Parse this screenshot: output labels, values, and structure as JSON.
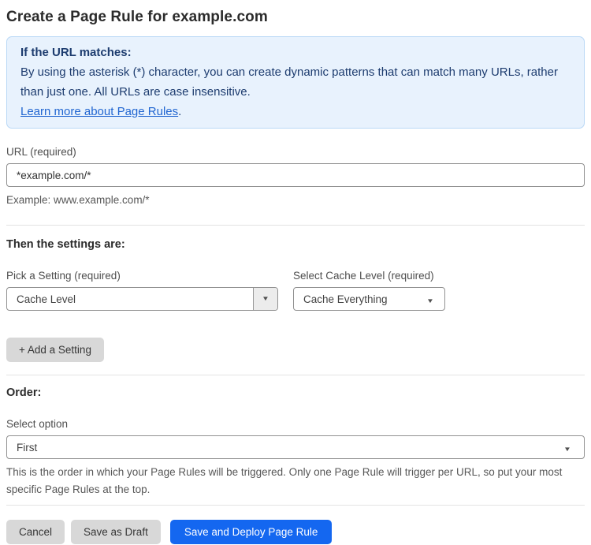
{
  "page": {
    "title": "Create a Page Rule for example.com"
  },
  "info_box": {
    "heading": "If the URL matches:",
    "body": "By using the asterisk (*) character, you can create dynamic patterns that can match many URLs, rather than just one. All URLs are case insensitive.",
    "link": "Learn more about Page Rules",
    "link_suffix": "."
  },
  "url_field": {
    "label": "URL (required)",
    "value": "*example.com/*",
    "helper": "Example: www.example.com/*"
  },
  "settings_section": {
    "heading": "Then the settings are:",
    "setting_select": {
      "label": "Pick a Setting (required)",
      "value": "Cache Level"
    },
    "cache_level_select": {
      "label": "Select Cache Level (required)",
      "value": "Cache Everything"
    },
    "add_setting_button": "+ Add a Setting"
  },
  "order_section": {
    "heading": "Order:",
    "select_label": "Select option",
    "select_value": "First",
    "helper": "This is the order in which your Page Rules will be triggered. Only one Page Rule will trigger per URL, so put your most specific Page Rules at the top."
  },
  "footer": {
    "cancel": "Cancel",
    "save_draft": "Save as Draft",
    "save_deploy": "Save and Deploy Page Rule"
  },
  "icons": {
    "dropdown_arrow": "▼"
  },
  "colors": {
    "accent_blue": "#1467f0",
    "info_background": "#e8f2fd",
    "info_border": "#b9d8f6",
    "info_text": "#1d3c6f",
    "link_blue": "#2166d1",
    "gray_button": "#d8d8d8"
  }
}
